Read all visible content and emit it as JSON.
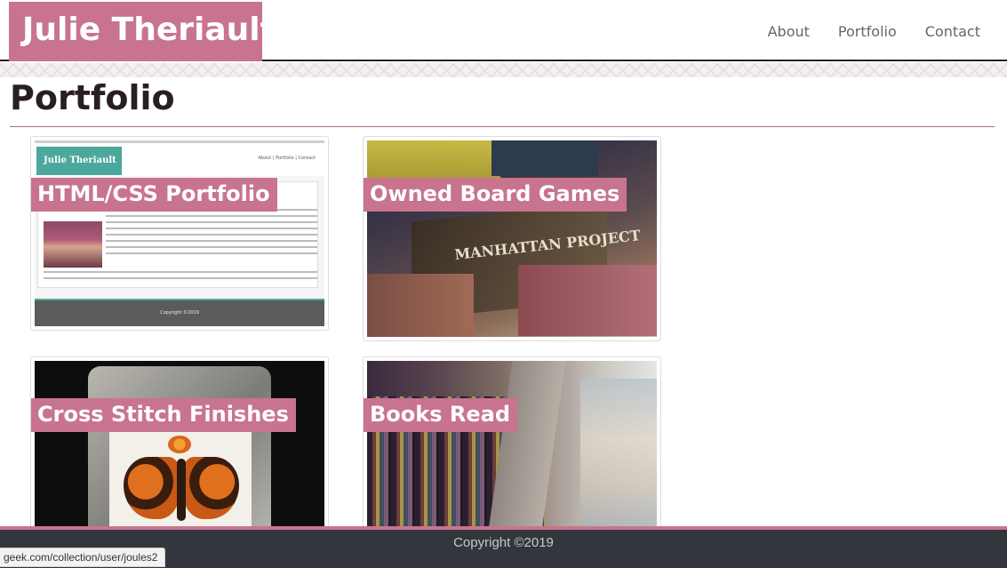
{
  "site": {
    "brand": "Julie Theriault",
    "nav": [
      "About",
      "Portfolio",
      "Contact"
    ],
    "accent_color": "#c8748e",
    "footer_color": "#33363c"
  },
  "page": {
    "title": "Portfolio"
  },
  "cards": [
    {
      "label": "HTML/CSS Portfolio",
      "thumb": {
        "brand": "Julie Theriault",
        "nav": "About  |  Portfolio  |  Contact",
        "footer": "Copyright ©2019"
      }
    },
    {
      "label": "Owned Board Games",
      "thumb_text": "MANHATTAN PROJECT"
    },
    {
      "label": "Cross Stitch Finishes"
    },
    {
      "label": "Books Read"
    }
  ],
  "footer": {
    "text": "Copyright ©2019"
  },
  "status_bar": {
    "url": "geek.com/collection/user/joules2"
  }
}
